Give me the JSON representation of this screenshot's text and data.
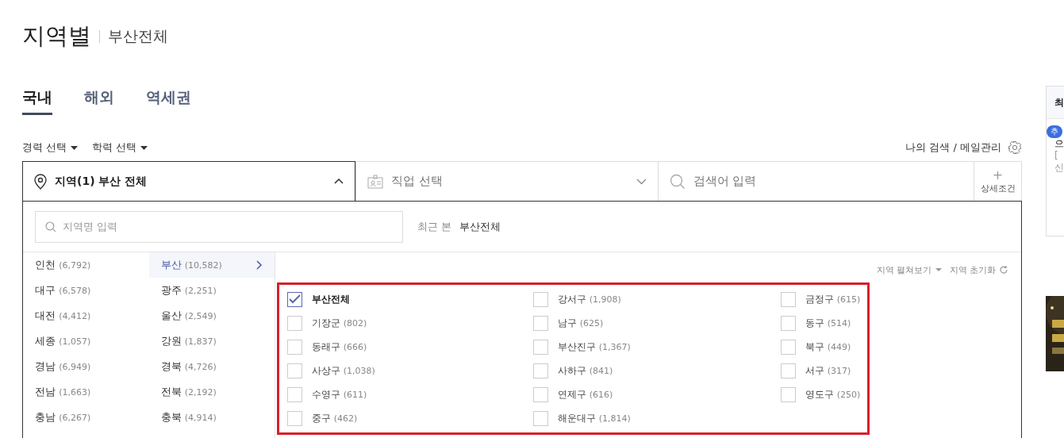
{
  "header": {
    "title": "지역별",
    "subtitle": "부산전체"
  },
  "tabs": [
    {
      "label": "국내",
      "selected": true
    },
    {
      "label": "해외",
      "selected": false
    },
    {
      "label": "역세권",
      "selected": false
    }
  ],
  "filters": [
    "경력 선택",
    "학력 선택"
  ],
  "my_search": "나의 검색 / 메일관리",
  "search_bar": {
    "region": "지역(1) 부산 전체",
    "job_placeholder": "직업 선택",
    "keyword_placeholder": "검색어 입력",
    "detail_icon": "+",
    "detail": "상세조건"
  },
  "region_panel": {
    "search_placeholder": "지역명 입력",
    "recent_label": "최근 본",
    "recent_value": "부산전체",
    "regions_left": [
      {
        "name": "인천",
        "count": "(6,792)",
        "selected": false
      },
      {
        "name": "대구",
        "count": "(6,578)",
        "selected": false
      },
      {
        "name": "대전",
        "count": "(4,412)",
        "selected": false
      },
      {
        "name": "세종",
        "count": "(1,057)",
        "selected": false
      },
      {
        "name": "경남",
        "count": "(6,949)",
        "selected": false
      },
      {
        "name": "전남",
        "count": "(1,663)",
        "selected": false
      },
      {
        "name": "충남",
        "count": "(6,267)",
        "selected": false
      }
    ],
    "regions_right": [
      {
        "name": "부산",
        "count": "(10,582)",
        "selected": true
      },
      {
        "name": "광주",
        "count": "(2,251)",
        "selected": false
      },
      {
        "name": "울산",
        "count": "(2,549)",
        "selected": false
      },
      {
        "name": "강원",
        "count": "(1,837)",
        "selected": false
      },
      {
        "name": "경북",
        "count": "(4,726)",
        "selected": false
      },
      {
        "name": "전북",
        "count": "(2,192)",
        "selected": false
      },
      {
        "name": "충북",
        "count": "(4,914)",
        "selected": false
      }
    ],
    "expand_view": "지역 펼쳐보기",
    "reset": "지역 초기화",
    "districts": [
      {
        "name": "부산전체",
        "checked": true
      },
      {
        "name": "강서구",
        "count": "(1,908)",
        "checked": false
      },
      {
        "name": "금정구",
        "count": "(615)",
        "checked": false
      },
      {
        "name": "기장군",
        "count": "(802)",
        "checked": false
      },
      {
        "name": "남구",
        "count": "(625)",
        "checked": false
      },
      {
        "name": "동구",
        "count": "(514)",
        "checked": false
      },
      {
        "name": "동래구",
        "count": "(666)",
        "checked": false
      },
      {
        "name": "부산진구",
        "count": "(1,367)",
        "checked": false
      },
      {
        "name": "북구",
        "count": "(449)",
        "checked": false
      },
      {
        "name": "사상구",
        "count": "(1,038)",
        "checked": false
      },
      {
        "name": "사하구",
        "count": "(841)",
        "checked": false
      },
      {
        "name": "서구",
        "count": "(317)",
        "checked": false
      },
      {
        "name": "수영구",
        "count": "(611)",
        "checked": false
      },
      {
        "name": "연제구",
        "count": "(616)",
        "checked": false
      },
      {
        "name": "영도구",
        "count": "(250)",
        "checked": false
      },
      {
        "name": "중구",
        "count": "(462)",
        "checked": false
      },
      {
        "name": "해운대구",
        "count": "(1,814)",
        "checked": false
      }
    ]
  },
  "side": {
    "tab": "최",
    "badge": "추",
    "line_1": "으",
    "line_2": "[",
    "line_3": "신"
  }
}
